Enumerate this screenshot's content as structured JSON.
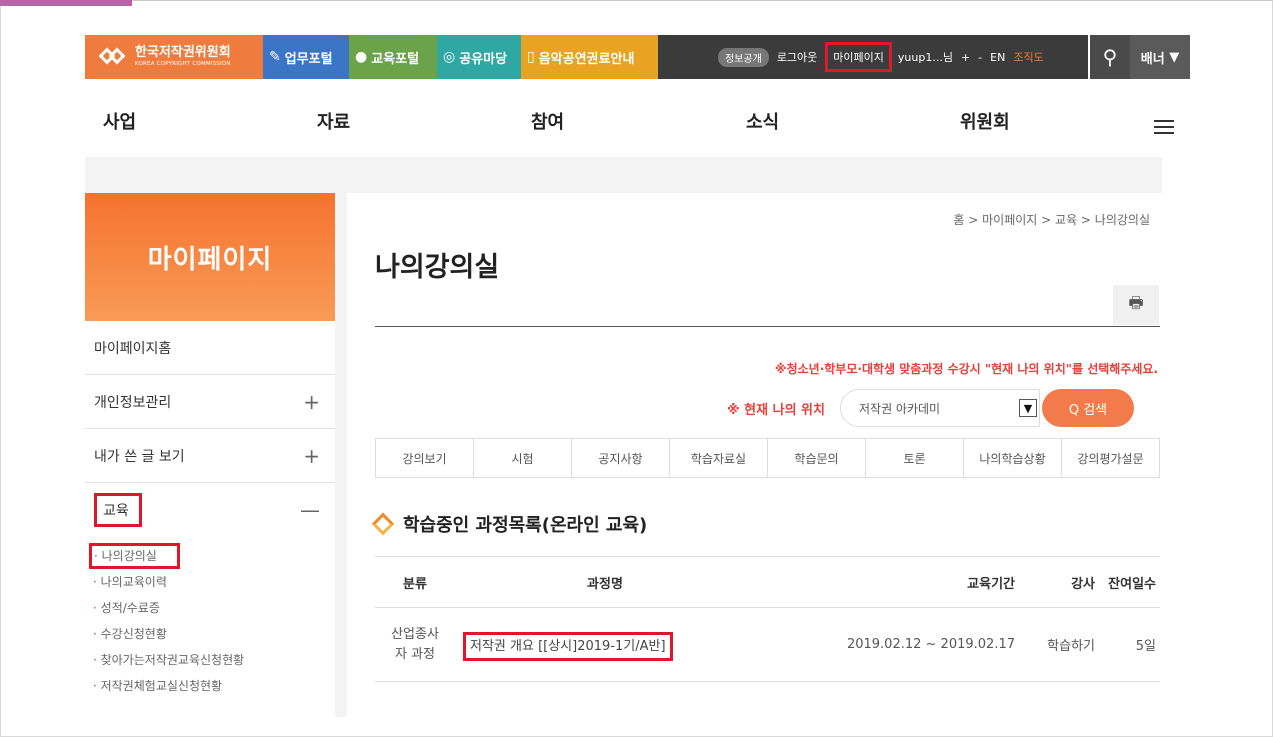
{
  "topbar": {
    "logo_name": "한국저작권위원회",
    "logo_sub": "KOREA COPYRIGHT COMMISSION",
    "menus": [
      "업무포털",
      "교육포털",
      "공유마당",
      "음악공연권료안내"
    ],
    "info_public": "정보공개",
    "logout": "로그아웃",
    "mypage": "마이페이지",
    "user": "yuup1...님",
    "plus": "+",
    "minus": "-",
    "en": "EN",
    "orgchart": "조직도",
    "banner": "배너"
  },
  "gnb": [
    "사업",
    "자료",
    "참여",
    "소식",
    "위원회"
  ],
  "lnb": {
    "title": "마이페이지",
    "items": [
      "마이페이지홈",
      "개인정보관리",
      "내가 쓴 글 보기",
      "교육"
    ],
    "plus": "+",
    "minus": "—",
    "sub": [
      "나의강의실",
      "나의교육이력",
      "성적/수료증",
      "수강신청현황",
      "찾아가는저작권교육신청현황",
      "저작권체험교실신청현황"
    ]
  },
  "content": {
    "breadcrumb": "홈 > 마이페이지 > 교육 > 나의강의실",
    "title": "나의강의실",
    "notice": "※청소년·학부모·대학생 맞춤과정 수강시 \"현재 나의 위치\"를 선택해주세요.",
    "loc_label": "※ 현재 나의 위치",
    "loc_value": "저작권 아카데미",
    "search": "Q 검색",
    "tabs": [
      "강의보기",
      "시험",
      "공지사항",
      "학습자료실",
      "학습문의",
      "토론",
      "나의학습상황",
      "강의평가설문"
    ],
    "section_title": "학습중인 과정목록(온라인 교육)",
    "table": {
      "headers": [
        "분류",
        "과정명",
        "교육기간",
        "강사",
        "잔여일수"
      ],
      "row": {
        "category": "산업종사자 과정",
        "course": "저작권 개요 [[상시]2019-1기/A반]",
        "period": "2019.02.12 ~ 2019.02.17",
        "teacher": "학습하기",
        "remaining": "5일"
      }
    }
  },
  "colors": {
    "accent": "#f6722f",
    "highlight": "#e0162b"
  }
}
